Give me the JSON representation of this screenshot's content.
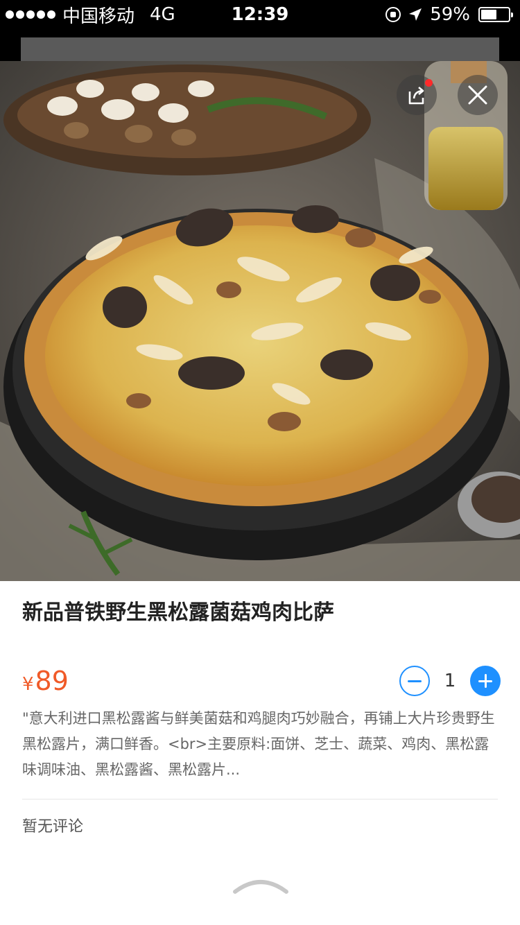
{
  "status_bar": {
    "carrier": "中国移动",
    "network": "4G",
    "time": "12:39",
    "battery_percent": "59%",
    "battery_level": 0.59,
    "icons": [
      "signal-dots-icon",
      "rotation-lock-icon",
      "location-arrow-icon",
      "battery-icon"
    ]
  },
  "hero": {
    "image_subject": "pizza",
    "share_icon": "share-icon",
    "close_icon": "close-icon",
    "has_notification_dot": true
  },
  "product": {
    "title": "新品普铁野生黑松露菌菇鸡肉比萨",
    "currency": "¥",
    "price": "89",
    "quantity": "1",
    "description": "\"意大利进口黑松露酱与鲜美菌菇和鸡腿肉巧妙融合，再铺上大片珍贵野生黑松露片，满口鲜香。<br>主要原料:面饼、芝士、蔬菜、鸡肉、黑松露味调味油、黑松露酱、黑松露片..."
  },
  "reviews": {
    "empty_text": "暂无评论"
  },
  "colors": {
    "price": "#f05a28",
    "accent_blue": "#1e90ff",
    "notification_red": "#ff2a2a"
  }
}
